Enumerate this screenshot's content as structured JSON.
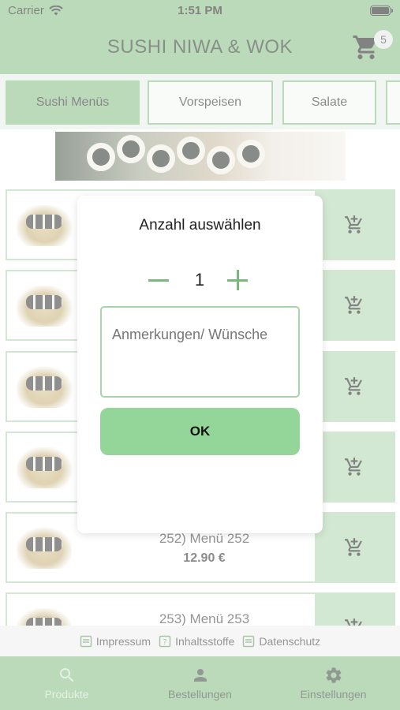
{
  "status_bar": {
    "carrier": "Carrier",
    "time": "1:51 PM"
  },
  "header": {
    "title": "SUSHI NIWA & WOK",
    "cart_count": "5"
  },
  "tabs": [
    {
      "label": "Sushi Menüs",
      "active": true
    },
    {
      "label": "Vorspeisen",
      "active": false
    },
    {
      "label": "Salate",
      "active": false
    }
  ],
  "products": [
    {
      "name": "",
      "price": ""
    },
    {
      "name": "",
      "price": ""
    },
    {
      "name": "",
      "price": ""
    },
    {
      "name": "",
      "price": ""
    },
    {
      "name": "252) Menü 252",
      "price": "12.90 €"
    },
    {
      "name": "253) Menü 253",
      "price": ""
    }
  ],
  "footer_links": {
    "impressum": "Impressum",
    "inhaltsstoffe": "Inhaltsstoffe",
    "datenschutz": "Datenschutz"
  },
  "tab_bar": {
    "produkte": "Produkte",
    "bestellungen": "Bestellungen",
    "einstellungen": "Einstellungen"
  },
  "modal": {
    "title": "Anzahl auswählen",
    "quantity": "1",
    "notes_placeholder": "Anmerkungen/ Wünsche",
    "notes_value": "",
    "ok_label": "OK"
  },
  "colors": {
    "primary": "#7bb87b",
    "accent_light": "#a9d3a9",
    "ok_button": "#94d69a"
  }
}
